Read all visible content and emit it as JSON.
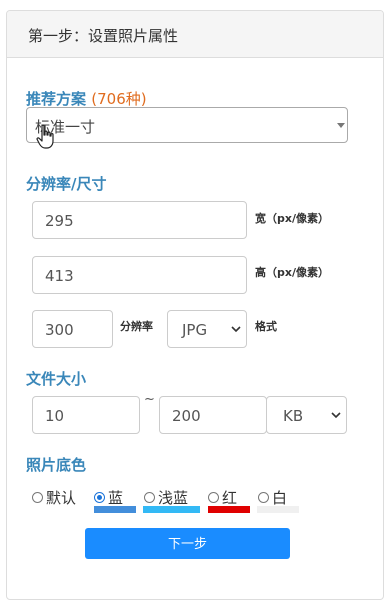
{
  "panel": {
    "title": "第一步：设置照片属性"
  },
  "plan": {
    "label": "推荐方案",
    "count": "(706种)",
    "selected": "标准一寸"
  },
  "size": {
    "label": "分辨率/尺寸",
    "width_value": "295",
    "width_unit": "宽（px/像素）",
    "height_value": "413",
    "height_unit": "高（px/像素）",
    "dpi_value": "300",
    "dpi_label": "分辨率",
    "format_value": "JPG",
    "format_label": "格式"
  },
  "filesize": {
    "label": "文件大小",
    "min": "10",
    "separator": "~",
    "max": "200",
    "unit": "KB"
  },
  "bg": {
    "label": "照片底色",
    "options": [
      {
        "label": "默认",
        "checked": false,
        "color": ""
      },
      {
        "label": "蓝",
        "checked": true,
        "color": "#438edb"
      },
      {
        "label": "浅蓝",
        "checked": false,
        "color": "#33b9f5"
      },
      {
        "label": "红",
        "checked": false,
        "color": "#e00000"
      },
      {
        "label": "白",
        "checked": false,
        "color": "#f0f0f0"
      }
    ]
  },
  "actions": {
    "next": "下一步"
  }
}
